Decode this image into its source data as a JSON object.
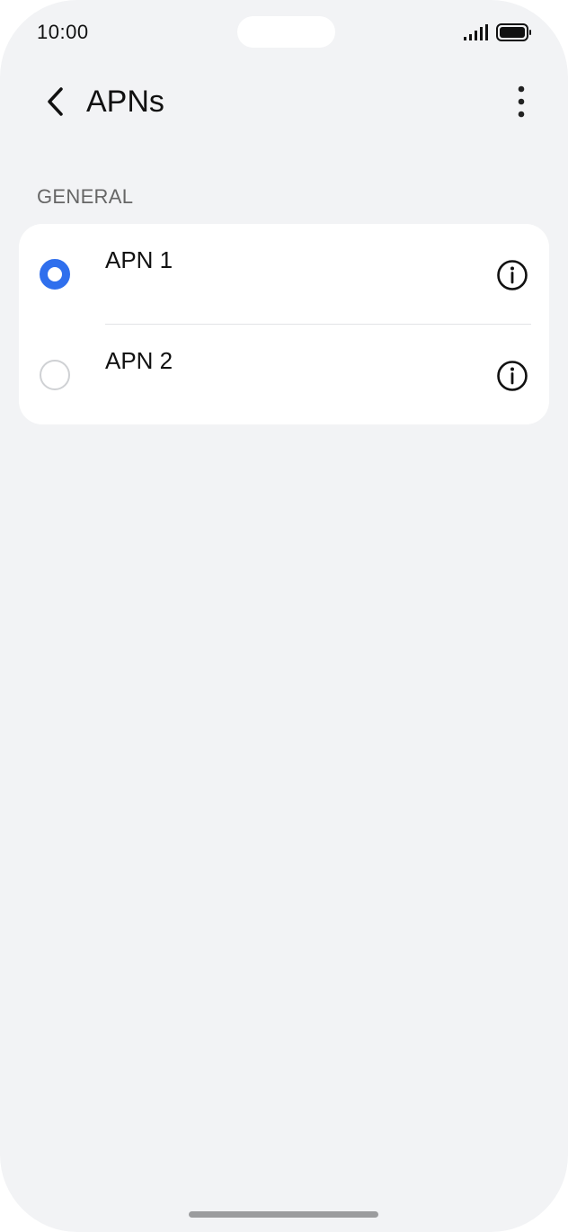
{
  "status_bar": {
    "time": "10:00",
    "signal_icon": "cellular-signal-icon",
    "battery_icon": "battery-icon"
  },
  "header": {
    "back_icon": "chevron-left-icon",
    "title": "APNs",
    "more_icon": "more-vertical-icon"
  },
  "section": {
    "title": "GENERAL"
  },
  "apns": [
    {
      "label": "APN 1",
      "selected": true
    },
    {
      "label": "APN 2",
      "selected": false
    }
  ],
  "colors": {
    "accent": "#2f6fed",
    "background": "#f2f3f5",
    "card": "#ffffff"
  }
}
